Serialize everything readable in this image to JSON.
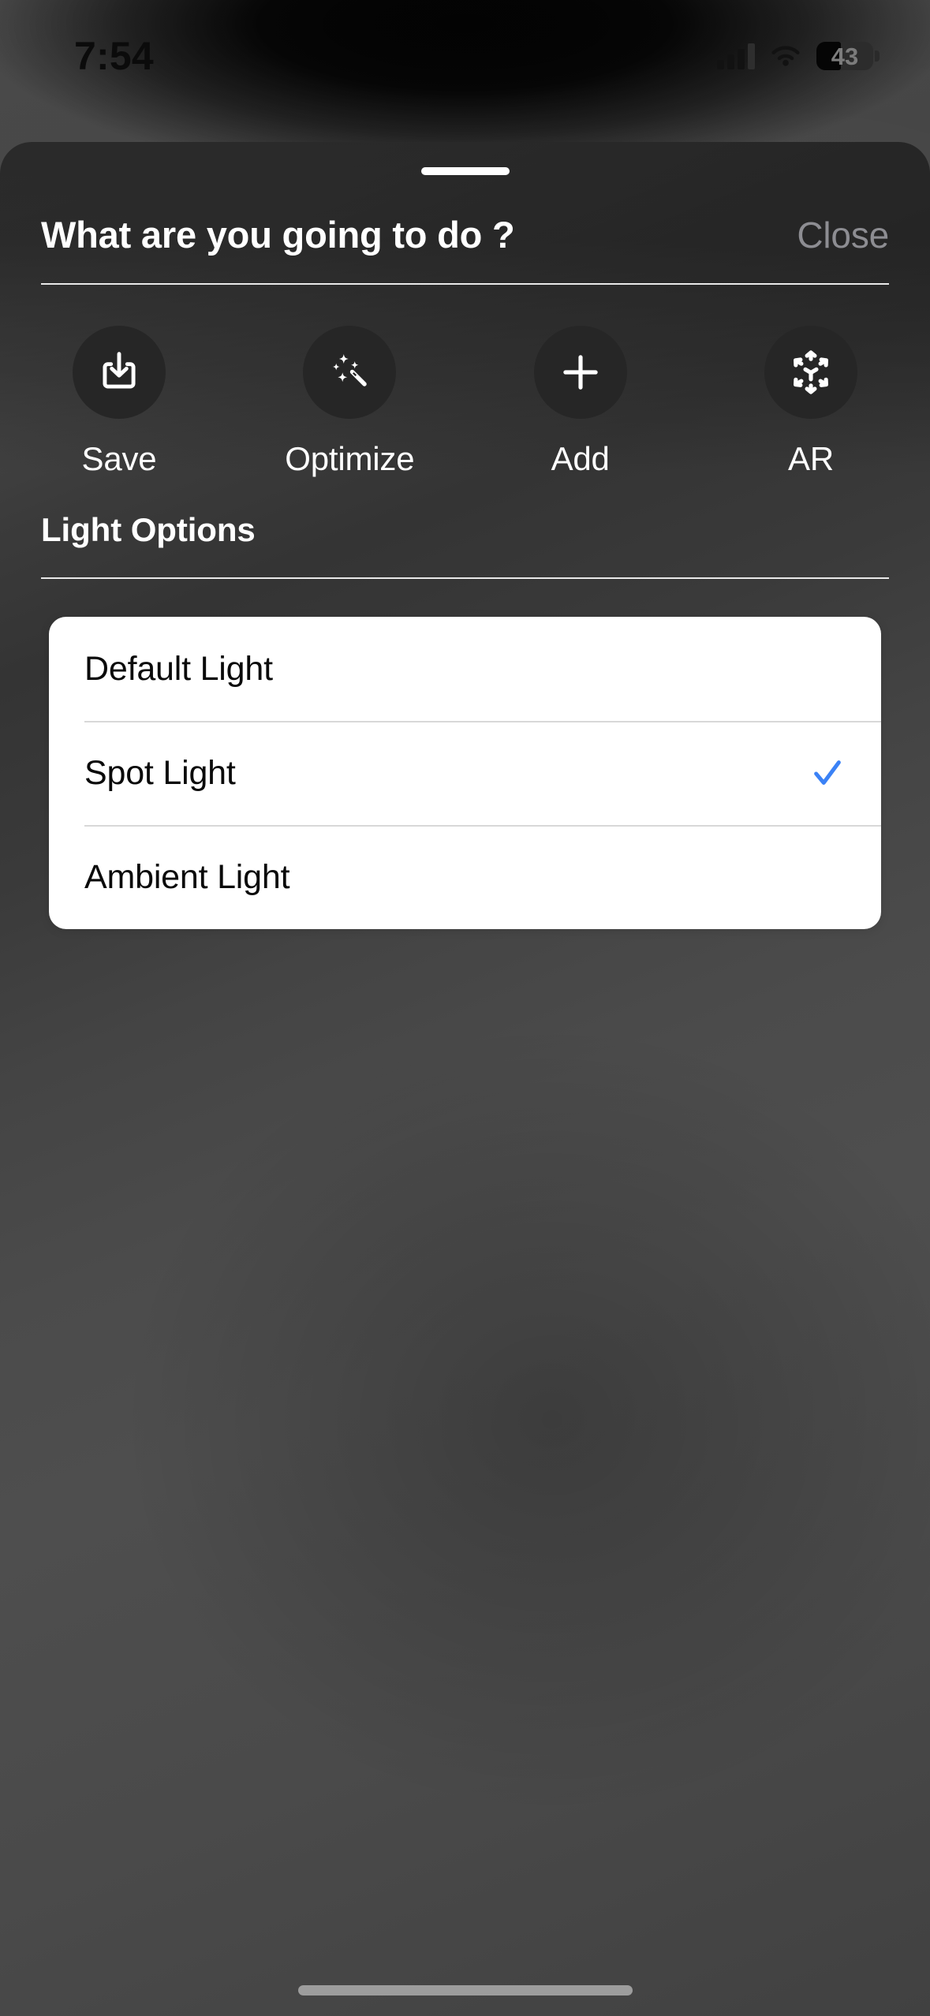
{
  "status_bar": {
    "time": "7:54",
    "cellular_icon": "cellular-bars-icon",
    "wifi_icon": "wifi-icon",
    "battery_percent": "43",
    "battery_level": 43
  },
  "sheet": {
    "grabber": "sheet-grabber",
    "title": "What are you going to do ?",
    "close_label": "Close",
    "actions": [
      {
        "id": "save",
        "label": "Save",
        "icon": "download-tray-icon"
      },
      {
        "id": "optimize",
        "label": "Optimize",
        "icon": "magic-wand-sparkles-icon"
      },
      {
        "id": "add",
        "label": "Add",
        "icon": "plus-icon"
      },
      {
        "id": "ar",
        "label": "AR",
        "icon": "ar-cube-icon"
      }
    ],
    "section": {
      "title": "Light Options",
      "options": [
        {
          "id": "default-light",
          "label": "Default Light",
          "selected": false
        },
        {
          "id": "spot-light",
          "label": "Spot Light",
          "selected": true
        },
        {
          "id": "ambient-light",
          "label": "Ambient Light",
          "selected": false
        }
      ],
      "selected_value": "Spot Light",
      "check_icon": "checkmark-icon"
    }
  },
  "colors": {
    "accent_blue": "#3B82F6",
    "sheet_background": "#3f3f3f",
    "card_background": "#FFFFFF",
    "icon_circle": "#262626",
    "close_gray": "#8D8D92",
    "divider": "#E9E9E9",
    "home_indicator": "#9D9D9D"
  },
  "home_indicator": "home-indicator"
}
